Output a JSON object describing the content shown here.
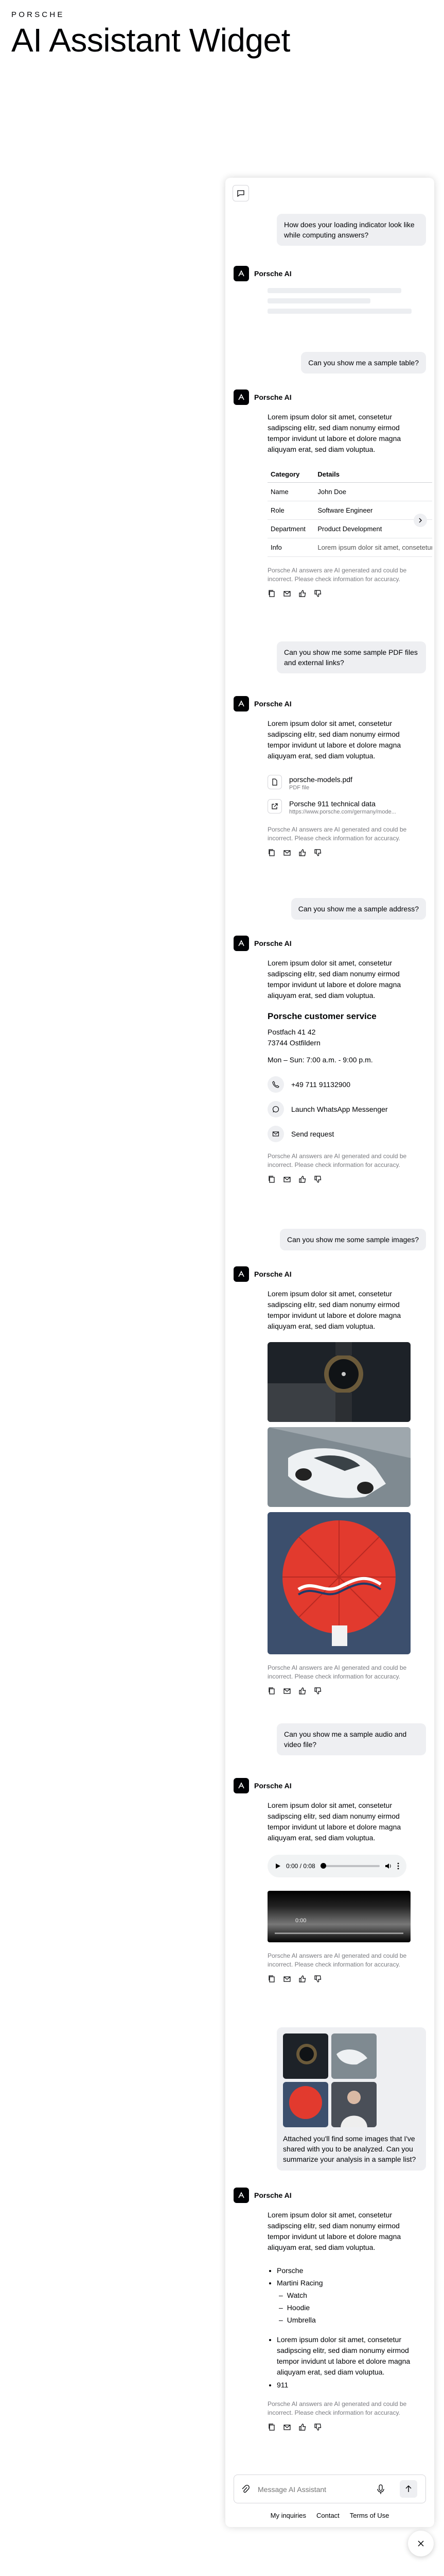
{
  "page": {
    "brand": "PORSCHE",
    "title": "AI Assistant Widget"
  },
  "widget": {
    "assistant_name": "Porsche AI",
    "lorem": "Lorem ipsum dolor sit amet, consetetur sadipscing elitr, sed diam nonumy eirmod tempor invidunt ut labore et dolore magna aliquyam erat, sed diam voluptua.",
    "disclaimer": "Porsche AI answers are AI generated and could be incorrect. Please check information for accuracy.",
    "msg1": "How does your loading indicator look like while computing answers?",
    "msg2": "Can you show me a sample table?",
    "table": {
      "headers": [
        "Category",
        "Details"
      ],
      "rows": [
        [
          "Name",
          "John Doe"
        ],
        [
          "Role",
          "Software Engineer"
        ],
        [
          "Department",
          "Product Development"
        ],
        [
          "Info",
          "Lorem ipsum dolor sit amet, consetetur"
        ]
      ]
    },
    "msg3": "Can you show me some sample PDF files and external links?",
    "files": [
      {
        "name": "porsche-models.pdf",
        "meta": "PDF file"
      },
      {
        "name": "Porsche 911 technical data",
        "meta": "https://www.porsche.com/germany/mode..."
      }
    ],
    "msg4": "Can you show me a sample address?",
    "address": {
      "heading": "Porsche customer service",
      "line1": "Postfach 41 42",
      "line2": "73744 Ostfildern",
      "hours": "Mon – Sun: 7:00 a.m. - 9:00 p.m.",
      "phone": "+49 711 91132900",
      "whatsapp": "Launch WhatsApp Messenger",
      "request": "Send request"
    },
    "msg5": "Can you show me some sample images?",
    "msg6": "Can you show me a sample audio and video file?",
    "audio_time": "0:00 / 0:08",
    "video_time": "0:00",
    "msg7": "Attached you'll find some images that I've shared with you to be analyzed. Can you summarize your analysis in a sample list?",
    "list": {
      "a": "Porsche",
      "b": "Martini Racing",
      "b_sub": [
        "Watch",
        "Hoodie",
        "Umbrella"
      ],
      "c": "Lorem ipsum dolor sit amet, consetetur sadipscing elitr, sed diam nonumy eirmod tempor invidunt ut labore et dolore magna aliquyam erat, sed diam voluptua.",
      "d": "911"
    },
    "input_placeholder": "Message AI Assistant",
    "footer": [
      "My inquiries",
      "Contact",
      "Terms of Use"
    ]
  }
}
